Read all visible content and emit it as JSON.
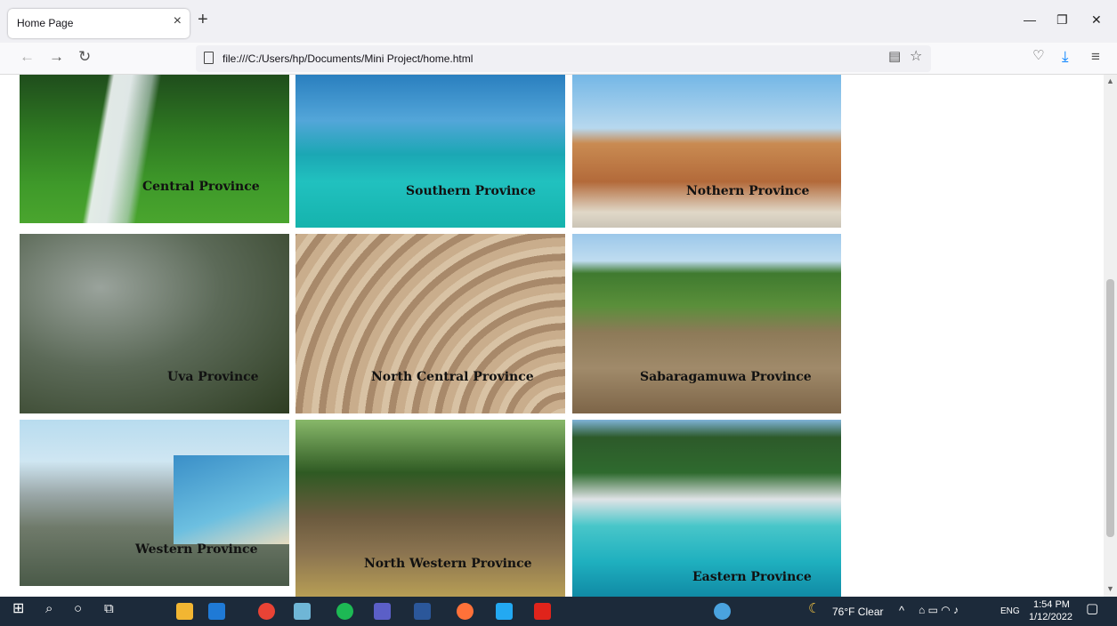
{
  "browser": {
    "tab_title": "Home Page",
    "tab_close": "×",
    "new_tab": "+",
    "url": "file:///C:/Users/hp/Documents/Mini Project/home.html"
  },
  "provinces": [
    {
      "label": "Central Province"
    },
    {
      "label": "Southern Province"
    },
    {
      "label": "Nothern Province"
    },
    {
      "label": "Uva Province"
    },
    {
      "label": "North Central Province"
    },
    {
      "label": "Sabaragamuwa Province"
    },
    {
      "label": "Western Province"
    },
    {
      "label": "North Western Province"
    },
    {
      "label": "Eastern Province"
    }
  ],
  "taskbar": {
    "weather": "76°F  Clear",
    "language": "ENG",
    "time": "1:54 PM",
    "date": "1/12/2022"
  },
  "colors": {
    "taskbar_bg": "#1c2a3a",
    "accent_download": "#0a84ff"
  }
}
